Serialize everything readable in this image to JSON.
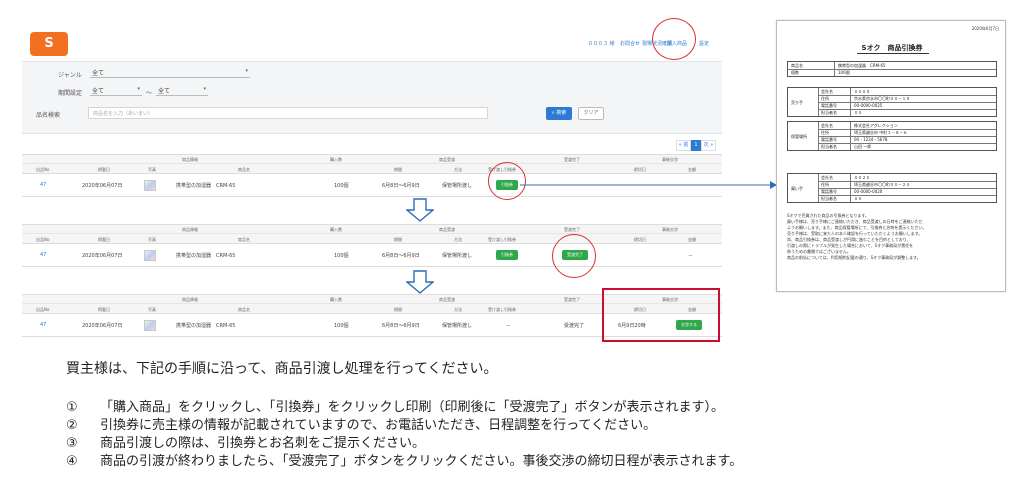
{
  "app": {
    "logo": "S",
    "nav": [
      "０００３ 様",
      "お問合せ",
      "現場状況確認",
      "購入商品",
      "設定"
    ],
    "search": {
      "genre_label": "ジャンル",
      "genre_value": "全て",
      "period_label": "期間設定",
      "period_from": "全て",
      "period_sep": "～",
      "period_to": "全て",
      "keyword_label": "品名検索",
      "keyword_placeholder": "商品名を入力（あいまい）",
      "search_button": "検索",
      "clear_button": "クリア"
    },
    "pager": {
      "prev": "« 前",
      "current": "1",
      "next": "次 »"
    },
    "table_groups": {
      "product": "商品情報",
      "qty": "購入数",
      "delivery": "商品受渡",
      "complete": "受渡完了",
      "exchange": "事後交渉"
    },
    "table_cols": {
      "id": "出品No",
      "date": "掲載日",
      "photo": "写真",
      "name": "商品名",
      "period": "期間",
      "method": "方法",
      "voucher": "受け渡し引換券",
      "deadline": "締切日",
      "amount": "金額"
    },
    "rows": [
      {
        "id": "47",
        "date": "2020年06月07日",
        "name": "携帯型の加湿器　CRM-65",
        "qty": "100個",
        "period": "6月8日～6月9日",
        "method": "保管場所渡し",
        "voucher_btn": "引換券",
        "complete": "",
        "deadline": "",
        "amount": ""
      },
      {
        "id": "47",
        "date": "2020年06月07日",
        "name": "携帯型の加湿器　CRM-65",
        "qty": "100個",
        "period": "6月8日～6月9日",
        "method": "保管場所渡し",
        "voucher_btn": "引換券",
        "complete_btn": "受渡完了",
        "deadline": "",
        "amount": "－"
      },
      {
        "id": "47",
        "date": "2020年06月07日",
        "name": "携帯型の加湿器　CRM-65",
        "qty": "100個",
        "period": "6月8日～6月9日",
        "method": "保管場所渡し",
        "voucher": "－",
        "complete": "受渡完了",
        "deadline": "6月9日20時",
        "exchange_btn": "交渉する"
      }
    ]
  },
  "doc": {
    "date": "2020年6月7日",
    "title": "Sオク　商品引換券",
    "item_rows": [
      {
        "k": "商品名",
        "v": "携帯型の加湿器　CRM-65"
      },
      {
        "k": "個数",
        "v": "100個"
      }
    ],
    "seller_label": "売り手",
    "seller_rows": [
      {
        "k": "会社名",
        "v": "０００５"
      },
      {
        "k": "住所",
        "v": "京水県京水市〇〇町００－１５"
      },
      {
        "k": "電話番号",
        "v": "00-0000-0025"
      },
      {
        "k": "担当者名",
        "v": "００"
      }
    ],
    "storage_label": "保管場所",
    "storage_rows": [
      {
        "k": "会社名",
        "v": "株式会社アグレクション"
      },
      {
        "k": "住所",
        "v": "埼玉県越谷市 中町１－８－６"
      },
      {
        "k": "電話番号",
        "v": "00 - 1234 - 5678"
      },
      {
        "k": "担当者名",
        "v": "山田 一郎"
      }
    ],
    "buyer_label": "買い手",
    "buyer_rows": [
      {
        "k": "会社名",
        "v": "００２０"
      },
      {
        "k": "住所",
        "v": "埼玉県越谷市〇〇町００－２０"
      },
      {
        "k": "電話番号",
        "v": "00-0000-0020"
      },
      {
        "k": "担当者名",
        "v": "００"
      }
    ],
    "notes": [
      "Sオクで売買された商品の引換券となります。",
      "買い手様は、売り手様にご連絡いただき、商品受渡しの日時をご連絡いただ",
      "ようお願いします。また、商品保管場所にて、引換券と名刺を提示ください。",
      "売り手様は、受取に来た人の本人確認を行っていただくようお願いします。",
      "尚、商品引換券は、商品受渡しが円滑に進むことを目的としており、",
      "引渡しの際にトラブルが発生した場合において、Sオク事務局が責任を",
      "負うための書類ではございません。",
      "商品の前払については、利用規約記載の通り、Sオク事務局が調整します。"
    ]
  },
  "instructions": {
    "intro": "買主様は、下記の手順に沿って、商品引渡し処理を行ってください。",
    "steps": [
      {
        "num": "①",
        "text": "「購入商品」をクリックし、「引換券」をクリックし印刷（印刷後に「受渡完了」ボタンが表示されます）。"
      },
      {
        "num": "②",
        "text": "引換券に売主様の情報が記載されていますので、お電話いただき、日程調整を行ってください。"
      },
      {
        "num": "③",
        "text": "商品引渡しの際は、引換券とお名刺をご提示ください。"
      },
      {
        "num": "④",
        "text": "商品の引渡が終わりましたら、「受渡完了」ボタンをクリックください。事後交渉の締切日程が表示されます。"
      }
    ]
  },
  "colors": {
    "brand": "#f37021",
    "accent": "#2c7ad6",
    "button_green": "#2ea84a",
    "highlight_red": "#d93030"
  }
}
